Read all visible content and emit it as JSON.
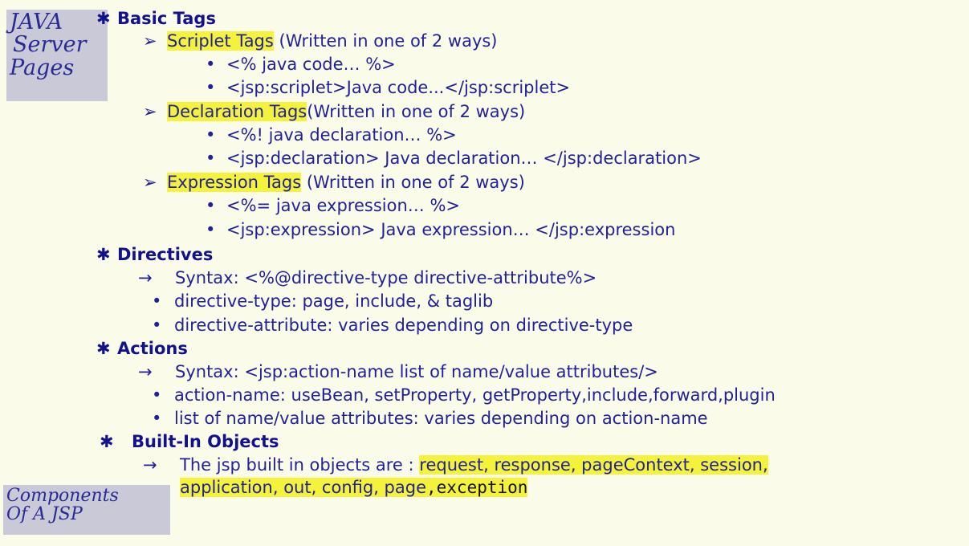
{
  "side_label_top": [
    "JAVA",
    "Server",
    "Pages"
  ],
  "side_label_bottom": [
    "Components",
    "Of A JSP"
  ],
  "bullets": {
    "star": "✱",
    "arrow": "➢",
    "dot": "•",
    "right_arrow": "→"
  },
  "sections": {
    "basic_tags": {
      "title": "Basic Tags",
      "scriptlet": {
        "name": "Scriplet Tags",
        "note": " (Written in one of 2 ways)",
        "items": [
          "<% java code… %>",
          "<jsp:scriplet>Java code...</jsp:scriplet>"
        ]
      },
      "declaration": {
        "name": "Declaration Tags",
        "note": "(Written in one of 2 ways)",
        "items": [
          "<%! java declaration… %>",
          "<jsp:declaration> Java declaration… </jsp:declaration>"
        ]
      },
      "expression": {
        "name": "Expression Tags",
        "note": " (Written in one of 2 ways)",
        "items": [
          "<%= java expression… %>",
          "<jsp:expression> Java expression… </jsp:expression"
        ]
      }
    },
    "directives": {
      "title": "Directives",
      "syntax": "Syntax: <%@directive-type  directive-attribute%>",
      "items": [
        "directive-type: page, include, & taglib",
        "directive-attribute: varies depending on directive-type"
      ]
    },
    "actions": {
      "title": "Actions",
      "syntax": "Syntax: <jsp:action-name list of name/value attributes/>",
      "items": [
        "action-name: useBean, setProperty, getProperty,include,forward,plugin",
        "list of name/value attributes: varies depending on action-name"
      ]
    },
    "builtin": {
      "title": "Built-In Objects",
      "intro": "The jsp built in objects are : ",
      "objects_line1": "request, response, pageContext, session,",
      "objects_line2": "application, out, config, page",
      "objects_last": ",exception"
    }
  }
}
